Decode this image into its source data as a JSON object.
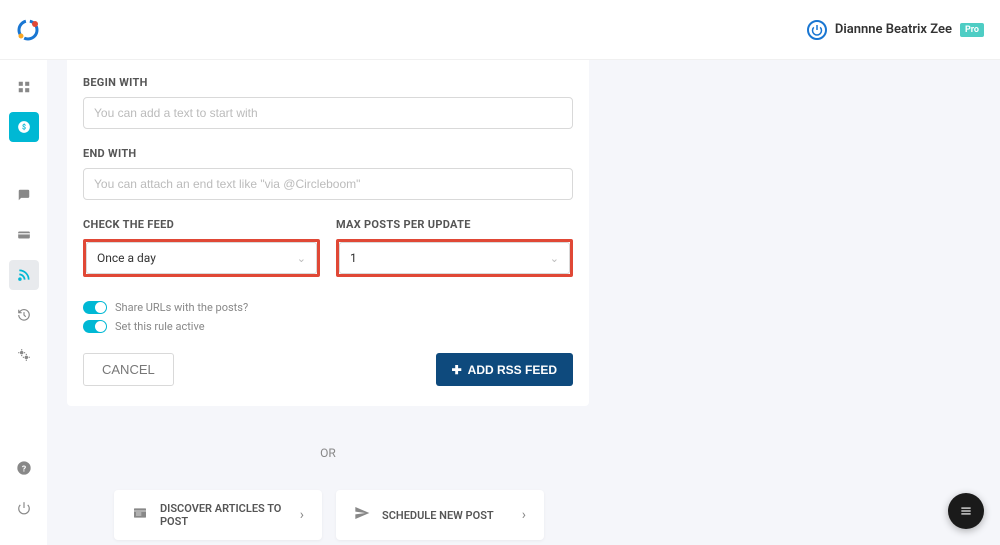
{
  "header": {
    "user_name": "Diannne Beatrix Zee",
    "badge": "Pro"
  },
  "form": {
    "begin_label": "BEGIN WITH",
    "begin_placeholder": "You can add a text to start with",
    "end_label": "END WITH",
    "end_placeholder": "You can attach an end text like \"via @Circleboom\"",
    "check_feed_label": "CHECK THE FEED",
    "check_feed_value": "Once a day",
    "max_posts_label": "MAX POSTS PER UPDATE",
    "max_posts_value": "1",
    "toggle_share": "Share URLs with the posts?",
    "toggle_active": "Set this rule active",
    "cancel_label": "CANCEL",
    "add_label": "ADD RSS FEED"
  },
  "or_text": "OR",
  "cards": {
    "discover": "DISCOVER ARTICLES TO POST",
    "schedule": "SCHEDULE NEW POST"
  }
}
